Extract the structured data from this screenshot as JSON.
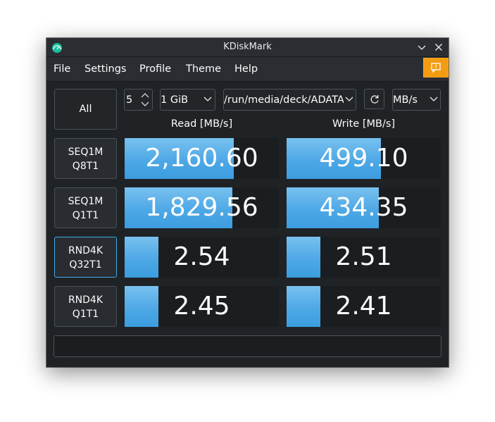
{
  "window": {
    "title": "KDiskMark"
  },
  "menu": [
    "File",
    "Settings",
    "Profile",
    "Theme",
    "Help"
  ],
  "toolbar": {
    "all_label": "All",
    "runs_value": "5",
    "size_value": "1 GiB",
    "path_value": "/run/media/deck/ADATA",
    "unit_value": "MB/s"
  },
  "headers": {
    "read": "Read [MB/s]",
    "write": "Write [MB/s]"
  },
  "tests": [
    {
      "line1": "SEQ1M",
      "line2": "Q8T1",
      "read": "2,160.60",
      "write": "499.10",
      "read_fraction": 0.71,
      "write_fraction": 0.61
    },
    {
      "line1": "SEQ1M",
      "line2": "Q1T1",
      "read": "1,829.56",
      "write": "434.35",
      "read_fraction": 0.7,
      "write_fraction": 0.6
    },
    {
      "line1": "RND4K",
      "line2": "Q32T1",
      "read": "2.54",
      "write": "2.51",
      "read_fraction": 0.22,
      "write_fraction": 0.22
    },
    {
      "line1": "RND4K",
      "line2": "Q1T1",
      "read": "2.45",
      "write": "2.41",
      "read_fraction": 0.22,
      "write_fraction": 0.22
    }
  ],
  "comment_value": "",
  "colors": {
    "accent": "#3daee9",
    "bar_fill": "#4ea8e6",
    "notice": "#f39c12",
    "background": "#202326"
  },
  "icons": [
    "kdiskmark-app-icon",
    "minimize-chevron-icon",
    "close-icon",
    "notice-icon",
    "spin-arrows-icon",
    "chevron-down-icon",
    "refresh-icon"
  ]
}
